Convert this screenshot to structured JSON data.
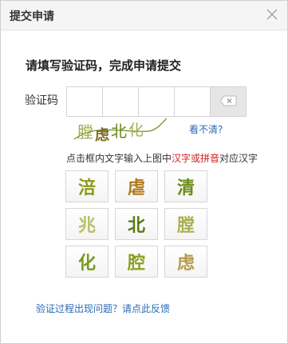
{
  "dialog": {
    "title": "提交申请",
    "close_icon": "close-icon"
  },
  "heading": "请填写验证码，完成申请提交",
  "code": {
    "label": "验证码",
    "cells": [
      "",
      "",
      "",
      ""
    ],
    "clear_icon": "backspace-icon"
  },
  "captcha": {
    "image_text": "膛虑北化",
    "refresh_label": "看不清?"
  },
  "hint": {
    "prefix": "点击框内文字输入上图中",
    "highlight": "汉字或拼音",
    "suffix": "对应汉字"
  },
  "chars": [
    {
      "char": "涪",
      "color": "#8a9a1a"
    },
    {
      "char": "虐",
      "color": "#b07a1a"
    },
    {
      "char": "清",
      "color": "#6b8a18"
    },
    {
      "char": "兆",
      "color": "#b8c06a"
    },
    {
      "char": "北",
      "color": "#5a7a12"
    },
    {
      "char": "膛",
      "color": "#a8b050"
    },
    {
      "char": "化",
      "color": "#7a9a20"
    },
    {
      "char": "腔",
      "color": "#8aa022"
    },
    {
      "char": "虑",
      "color": "#b49a4a"
    }
  ],
  "feedback_link": "验证过程出现问题？请点此反馈"
}
